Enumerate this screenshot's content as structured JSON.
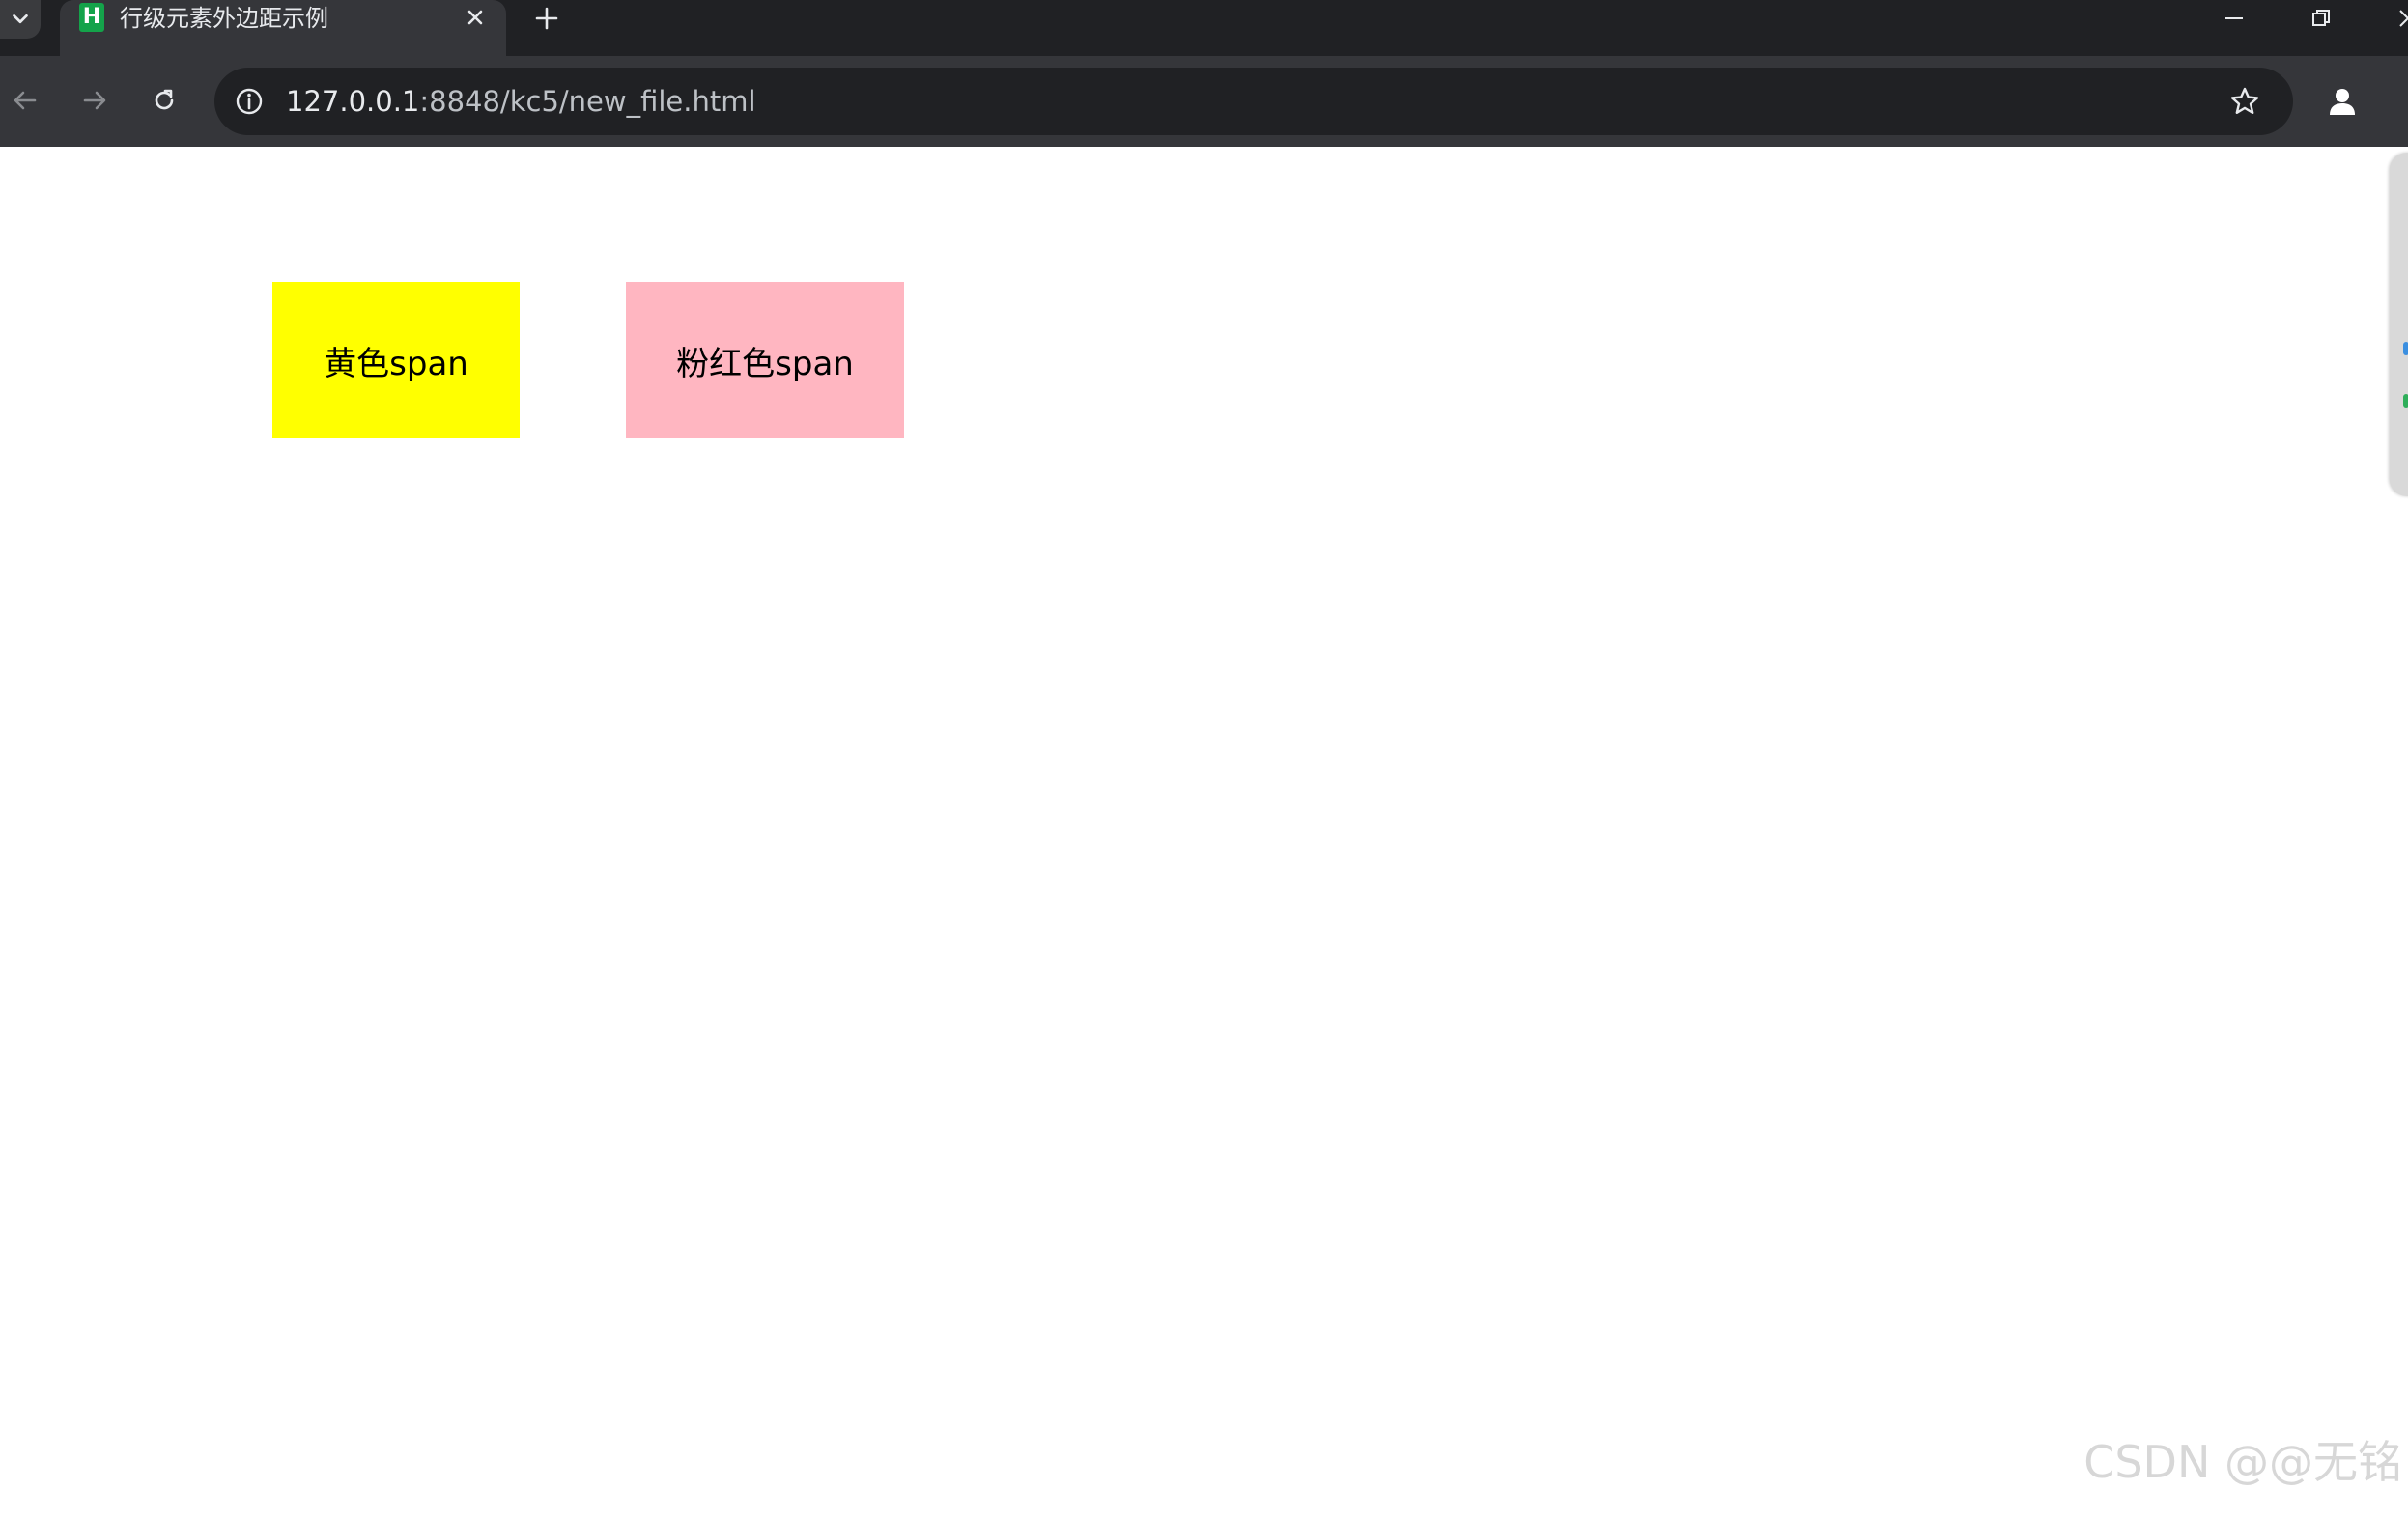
{
  "browser": {
    "tab": {
      "favicon_letter": "H",
      "title": "行级元素外边距示例"
    },
    "address_bar": {
      "host": "127.0.0.1",
      "path": ":8848/kc5/new_file.html"
    },
    "icons": {
      "tab_search": "chevron-down-icon",
      "tab_close": "close-icon",
      "new_tab": "plus-icon",
      "minimize": "minimize-icon",
      "restore": "restore-icon",
      "close_window": "close-icon",
      "back": "arrow-left-icon",
      "forward": "arrow-right-icon",
      "reload": "reload-icon",
      "site_info": "info-icon",
      "bookmark": "star-icon",
      "profile": "person-icon"
    }
  },
  "page": {
    "spans": [
      {
        "text": "黄色span",
        "background": "#ffff00"
      },
      {
        "text": "粉红色span",
        "background": "#ffb6c1"
      }
    ]
  },
  "watermark": {
    "text": "CSDN @@无铭"
  },
  "colors": {
    "tab_bar": "#202124",
    "toolbar": "#35363a",
    "omnibox": "#202124",
    "favicon": "#14a34a"
  }
}
